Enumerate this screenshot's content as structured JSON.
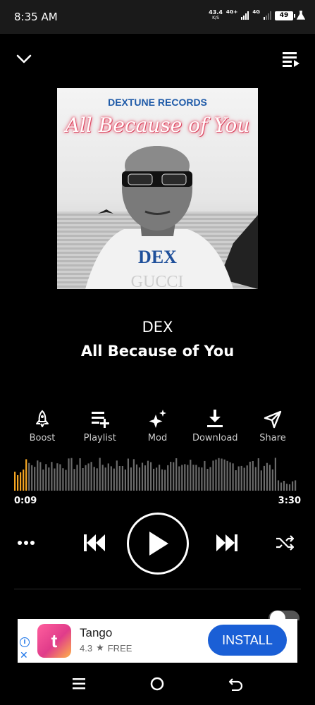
{
  "status": {
    "time": "8:35 AM",
    "net_speed_value": "43.4",
    "net_speed_unit": "K/S",
    "network_1": "4G+",
    "network_2": "4G",
    "battery": "49"
  },
  "header": {
    "collapse_icon": "chevron-down-icon",
    "queue_icon": "queue-music-icon"
  },
  "cover": {
    "label": "DEXTUNE RECORDS",
    "title": "All Because of You",
    "artist": "DEX"
  },
  "track": {
    "artist": "DEX",
    "title": "All Because of You"
  },
  "actions": [
    {
      "label": "Boost",
      "icon": "rocket-icon"
    },
    {
      "label": "Playlist",
      "icon": "playlist-add-icon"
    },
    {
      "label": "Mod",
      "icon": "sparkle-icon"
    },
    {
      "label": "Download",
      "icon": "download-icon"
    },
    {
      "label": "Share",
      "icon": "send-icon"
    }
  ],
  "progress": {
    "current": "0:09",
    "total": "3:30",
    "played_fraction": 0.043,
    "accent_color": "#f5a623"
  },
  "controls": {
    "more_icon": "more-horizontal-icon",
    "prev_icon": "skip-previous-icon",
    "play_icon": "play-icon",
    "next_icon": "skip-next-icon",
    "shuffle_icon": "shuffle-icon"
  },
  "ad": {
    "app_name": "Tango",
    "rating": "4.3",
    "price": "FREE",
    "cta": "INSTALL",
    "logo_text": "t"
  },
  "navbar": {
    "menu_icon": "menu-icon",
    "home_icon": "home-circle-icon",
    "back_icon": "back-icon"
  }
}
